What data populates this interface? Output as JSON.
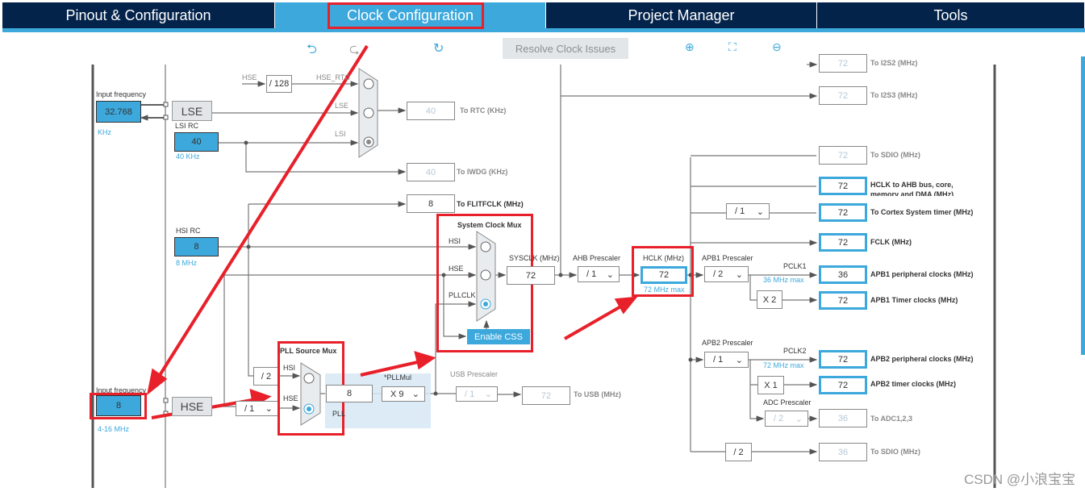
{
  "tabs": [
    {
      "label": "Pinout & Configuration"
    },
    {
      "label": "Clock Configuration"
    },
    {
      "label": "Project Manager"
    },
    {
      "label": "Tools"
    }
  ],
  "toolbar": {
    "undo_icon": "undo-icon",
    "redo_icon": "redo-icon",
    "reset_icon": "refresh-icon",
    "resolve_label": "Resolve Clock Issues",
    "zoom_in_icon": "zoom-in-icon",
    "fit_icon": "fit-icon",
    "zoom_out_icon": "zoom-out-icon"
  },
  "lse": {
    "input_label": "Input frequency",
    "value": "32.768",
    "unit": "KHz",
    "block": "LSE"
  },
  "lsi": {
    "label": "LSI RC",
    "value": "40",
    "unit": "40 KHz"
  },
  "rtc_mux": {
    "hse": "HSE",
    "div": "/ 128",
    "hse_rtc": "HSE_RTC",
    "lse": "LSE",
    "lsi": "LSI",
    "selected": "LSI"
  },
  "rtc": {
    "value": "40",
    "label": "To RTC (KHz)"
  },
  "iwdg": {
    "value": "40",
    "label": "To IWDG (KHz)"
  },
  "flit": {
    "value": "8",
    "label": "To FLITFCLK (MHz)"
  },
  "hsi": {
    "label": "HSI RC",
    "value": "8",
    "unit": "8 MHz"
  },
  "sys_mux": {
    "title": "System Clock Mux",
    "hsi": "HSI",
    "hse": "HSE",
    "pllclk": "PLLCLK",
    "selected": "PLLCLK",
    "css": "Enable CSS"
  },
  "sysclk": {
    "label": "SYSCLK (MHz)",
    "value": "72"
  },
  "ahb": {
    "label": "AHB Prescaler",
    "value": "/ 1"
  },
  "hclk": {
    "label": "HCLK (MHz)",
    "value": "72",
    "max": "72 MHz max"
  },
  "apb1": {
    "label": "APB1 Prescaler",
    "value": "/ 2",
    "pclk": "PCLK1",
    "max": "36 MHz max",
    "mult": "X 2"
  },
  "apb2": {
    "label": "APB2 Prescaler",
    "value": "/ 1",
    "pclk": "PCLK2",
    "max": "72 MHz max",
    "mult": "X 1"
  },
  "adc": {
    "label": "ADC Prescaler",
    "value": "/ 2"
  },
  "cortex_div": "/ 1",
  "sdio_div": "/ 2",
  "outputs": [
    {
      "value": "72",
      "label": "To I2S2 (MHz)"
    },
    {
      "value": "72",
      "label": "To I2S3 (MHz)"
    },
    {
      "value": "72",
      "label": "To SDIO (MHz)"
    },
    {
      "value": "72",
      "label": "HCLK to AHB bus, core, memory and DMA (MHz)"
    },
    {
      "value": "72",
      "label": "To Cortex System timer (MHz)"
    },
    {
      "value": "72",
      "label": "FCLK (MHz)"
    },
    {
      "value": "36",
      "label": "APB1 peripheral clocks (MHz)"
    },
    {
      "value": "72",
      "label": "APB1 Timer clocks (MHz)"
    },
    {
      "value": "72",
      "label": "APB2 peripheral clocks (MHz)"
    },
    {
      "value": "72",
      "label": "APB2 timer clocks (MHz)"
    },
    {
      "value": "36",
      "label": "To ADC1,2,3"
    },
    {
      "value": "36",
      "label": "To SDIO (MHz)"
    }
  ],
  "hse": {
    "input_label": "Input frequency",
    "value": "8",
    "unit": "4-16 MHz",
    "block": "HSE",
    "div": "/ 1"
  },
  "pll_mux": {
    "title": "PLL Source Mux",
    "hsi": "HSI",
    "hse": "HSE",
    "div2": "/ 2",
    "selected": "HSE"
  },
  "pll": {
    "label": "PLL",
    "value": "8",
    "mul_label": "*PLLMul",
    "mul": "X 9"
  },
  "usb": {
    "label": "USB Prescaler",
    "value": "/ 1",
    "out": "72",
    "out_label": "To USB (MHz)"
  },
  "watermark": "CSDN @小浪宝宝",
  "colors": {
    "nav": "#03234b",
    "accent": "#3ca8dc",
    "highlight": "#e8202a"
  }
}
